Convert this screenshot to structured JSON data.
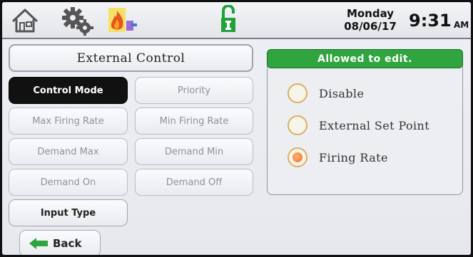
{
  "header": {
    "day": "Monday",
    "date": "08/06/17",
    "time": "9:31",
    "ampm": "AM",
    "icons": [
      "home-icon",
      "gears-icon",
      "flame-icon",
      "unlock-icon"
    ]
  },
  "page_title": "External Control",
  "menu": {
    "control_mode": "Control Mode",
    "priority": "Priority",
    "max_firing_rate": "Max Firing Rate",
    "min_firing_rate": "Min Firing Rate",
    "demand_max": "Demand Max",
    "demand_min": "Demand Min",
    "demand_on": "Demand On",
    "demand_off": "Demand Off",
    "input_type": "Input Type"
  },
  "back_label": "Back",
  "panel": {
    "banner": "Allowed to edit.",
    "options": [
      {
        "label": "Disable",
        "selected": false
      },
      {
        "label": "External Set Point",
        "selected": false
      },
      {
        "label": "Firing Rate",
        "selected": true
      }
    ]
  },
  "colors": {
    "banner_green": "#2fa43f",
    "radio_selected": "#f07020",
    "radio_ring": "#d9b260",
    "lock_green": "#22a03a"
  }
}
